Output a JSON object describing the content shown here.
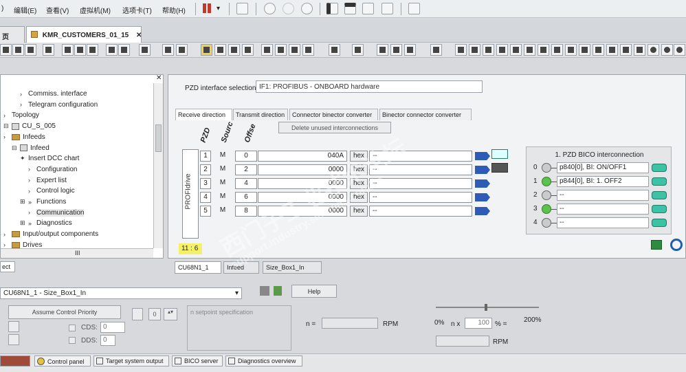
{
  "menu": [
    "编辑(E)",
    "查看(V)",
    "虚拟机(M)",
    "选项卡(T)",
    "帮助(H)"
  ],
  "tabs": {
    "prev": "页",
    "active": "KMR_CUSTOMERS_01_15",
    "close": "✕"
  },
  "tree": [
    {
      "label": "Commiss. interface",
      "indent": 2,
      "icon": "chevron"
    },
    {
      "label": "Telegram configuration",
      "indent": 2,
      "icon": "chevron"
    },
    {
      "label": "Topology",
      "indent": 0,
      "icon": "chevron"
    },
    {
      "label": "CU_S_005",
      "indent": 0,
      "icon": "device"
    },
    {
      "label": "Infeeds",
      "indent": 0,
      "icon": "folder"
    },
    {
      "label": "Infeed",
      "indent": 1,
      "icon": "device"
    },
    {
      "label": "Insert DCC chart",
      "indent": 2,
      "icon": "star"
    },
    {
      "label": "Configuration",
      "indent": 3,
      "icon": "chevron"
    },
    {
      "label": "Expert list",
      "indent": 3,
      "icon": "chevron"
    },
    {
      "label": "Control logic",
      "indent": 3,
      "icon": "chevron"
    },
    {
      "label": "Functions",
      "indent": 2,
      "icon": "dchevron"
    },
    {
      "label": "Communication",
      "indent": 3,
      "icon": "chevron",
      "selected": true
    },
    {
      "label": "Diagnostics",
      "indent": 2,
      "icon": "dchevron"
    },
    {
      "label": "Input/output components",
      "indent": 0,
      "icon": "folder"
    },
    {
      "label": "Drives",
      "indent": 0,
      "icon": "folder"
    }
  ],
  "tree_hscroll_label": "III",
  "tree_bottom": "ect",
  "pzd": {
    "selection_label": "PZD interface selection:",
    "selection_value": "IF1:  PROFIBUS - ONBOARD hardware",
    "tabs": [
      "Receive direction",
      "Transmit direction",
      "Connector binector converter",
      "Binector connector converter"
    ],
    "delete_button": "Delete unused interconnections",
    "col_heads": [
      "PZD",
      "Sourc",
      "Offse"
    ],
    "side_label": "PROFIdrive",
    "rows": [
      {
        "n": "1",
        "src": "M",
        "off": "0",
        "val": "040A",
        "hex": "hex",
        "dash": "--"
      },
      {
        "n": "2",
        "src": "M",
        "off": "2",
        "val": "0000",
        "hex": "hex",
        "dash": "--"
      },
      {
        "n": "3",
        "src": "M",
        "off": "4",
        "val": "0000",
        "hex": "hex",
        "dash": "--"
      },
      {
        "n": "4",
        "src": "M",
        "off": "6",
        "val": "0000",
        "hex": "hex",
        "dash": "--"
      },
      {
        "n": "5",
        "src": "M",
        "off": "8",
        "val": "0000",
        "hex": "hex",
        "dash": "--"
      }
    ],
    "bico_title": "1. PZD BICO interconnection",
    "bico": [
      {
        "n": "0",
        "text": "p840[0], BI: ON/OFF1",
        "green": false
      },
      {
        "n": "1",
        "text": "p844[0], BI: 1. OFF2",
        "green": true
      },
      {
        "n": "2",
        "text": "--",
        "green": false
      },
      {
        "n": "3",
        "text": "--",
        "green": true
      },
      {
        "n": "4",
        "text": "--",
        "green": false
      }
    ],
    "status": "11 : 6"
  },
  "bottom_tabs": [
    "CU68N1_1",
    "Infeed",
    "Size_Box1_In"
  ],
  "control": {
    "drive_select": "CU68N1_1 - Size_Box1_In",
    "help": "Help",
    "assume_priority": "Assume Control Priority",
    "stepper_value": "0",
    "setpoint_placeholder": "n setpoint specification",
    "cds_label": "CDS:",
    "cds_value": "0",
    "dds_label": "DDS:",
    "dds_value": "0",
    "n_eq": "n =",
    "rpm1": "RPM",
    "rpm2": "RPM",
    "pct0": "0%",
    "pct200": "200%",
    "n_x": "n x",
    "pct_val": "100",
    "pct_eq": "% ="
  },
  "taskbar": [
    "Control panel",
    "Target system output",
    "BICO server",
    "Diagnostics overview"
  ],
  "watermark": "西门子工业技术论坛",
  "watermark2": "support.industry.siemens.com/cs"
}
